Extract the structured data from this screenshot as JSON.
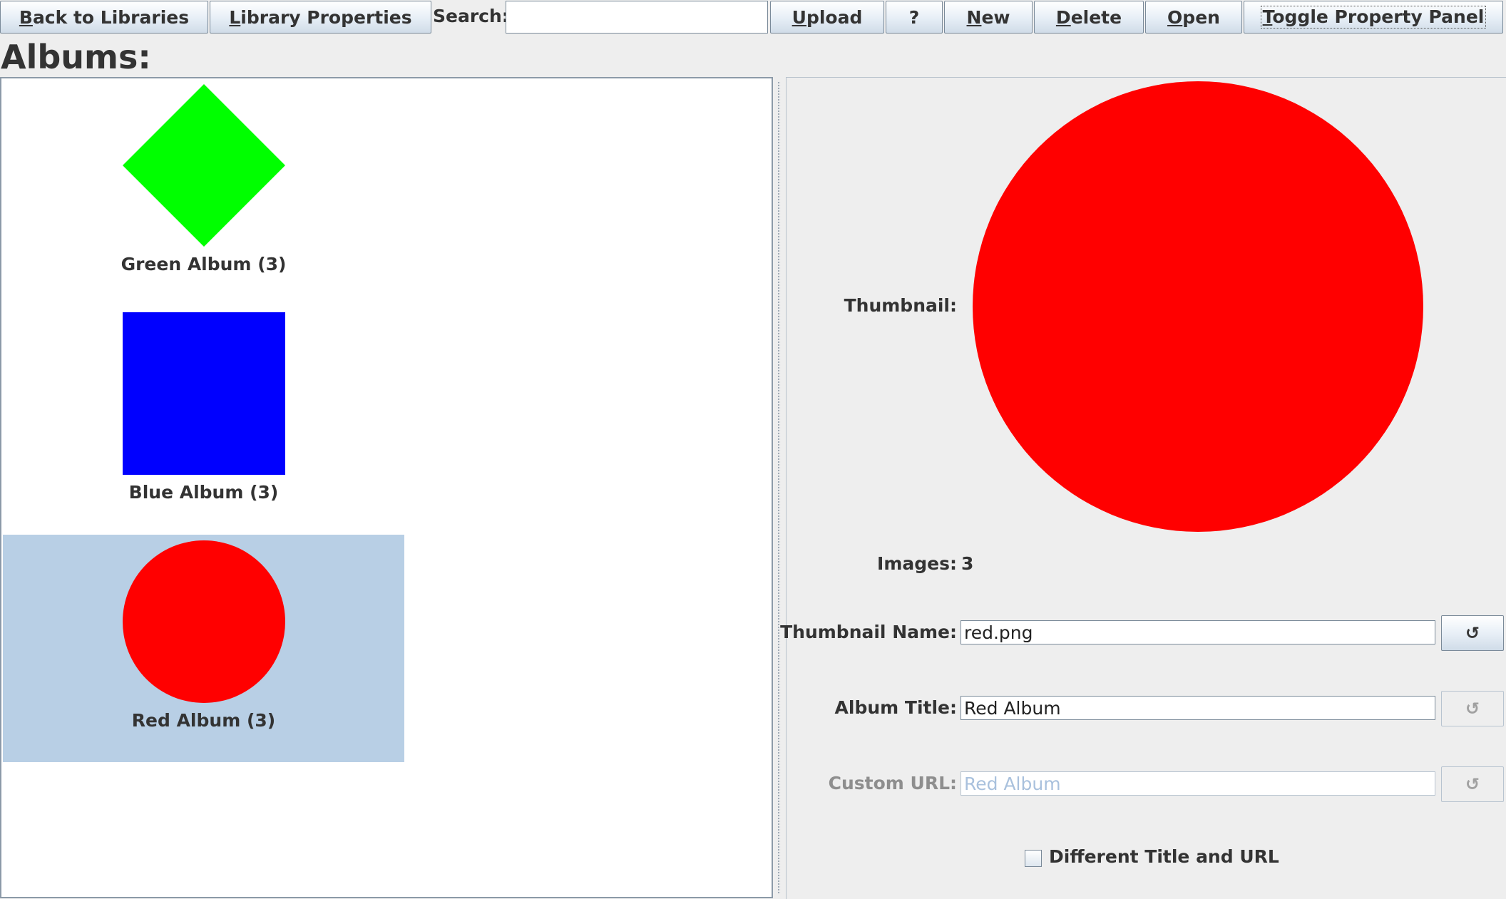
{
  "toolbar": {
    "back": {
      "mnemonic": "B",
      "rest": "ack to Libraries"
    },
    "properties": {
      "mnemonic": "L",
      "rest": "ibrary Properties"
    },
    "search_label": "Search:",
    "search_value": "",
    "upload": {
      "mnemonic": "U",
      "rest": "pload"
    },
    "help": "?",
    "new": {
      "mnemonic": "N",
      "rest": "ew"
    },
    "delete": {
      "mnemonic": "D",
      "rest": "elete"
    },
    "open": {
      "mnemonic": "O",
      "rest": "pen"
    },
    "toggle": {
      "mnemonic": "T",
      "rest": "oggle Property Panel"
    }
  },
  "page_title": "Albums:",
  "albums": [
    {
      "label": "Green Album (3)",
      "shape": "diamond",
      "color": "#00ff00",
      "selected": false
    },
    {
      "label": "Blue Album (3)",
      "shape": "square",
      "color": "#0000ff",
      "selected": false
    },
    {
      "label": "Red Album (3)",
      "shape": "circle",
      "color": "#ff0000",
      "selected": true
    }
  ],
  "properties": {
    "thumbnail_label": "Thumbnail:",
    "thumbnail_shape": "circle",
    "thumbnail_color": "#ff0000",
    "images_label": "Images:",
    "images_value": "3",
    "thumbnail_name_label": "Thumbnail Name:",
    "thumbnail_name_value": "red.png",
    "album_title_label": "Album Title:",
    "album_title_value": "Red Album",
    "custom_url_label": "Custom URL:",
    "custom_url_value": "Red Album",
    "reset_icon": "↺",
    "checkbox_label": "Different Title and URL",
    "checkbox_checked": false
  },
  "colors": {
    "selection": "#b8cfe5",
    "background": "#eeeeee"
  }
}
